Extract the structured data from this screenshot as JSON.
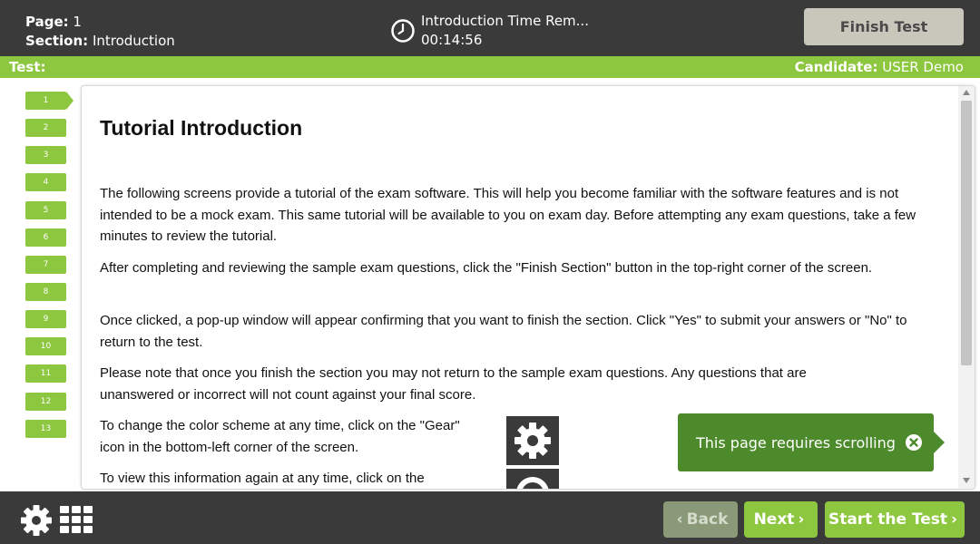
{
  "header": {
    "page_label": "Page:",
    "page_value": "1",
    "section_label": "Section:",
    "section_value": "Introduction",
    "timer_title": "Introduction Time Rem...",
    "timer_value": "00:14:56",
    "timer_icon": "clock-icon",
    "finish_button": "Finish Test"
  },
  "info_bar": {
    "test_label": "Test:",
    "candidate_label": "Candidate:",
    "candidate_name": "USER Demo"
  },
  "question_nav": {
    "items": [
      "1",
      "2",
      "3",
      "4",
      "5",
      "6",
      "7",
      "8",
      "9",
      "10",
      "11",
      "12",
      "13"
    ],
    "active": "1"
  },
  "content": {
    "title": "Tutorial Introduction",
    "paragraphs": [
      "The following screens provide a tutorial of the exam software. This will help you become familiar with the software features and is not intended to be a mock exam. This same tutorial will be available to you on exam day. Before attempting any exam questions, take a few minutes to review the tutorial.",
      "After completing and reviewing the sample exam questions, click the \"Finish Section\" button in the top-right corner of the screen.",
      "Once clicked, a pop-up window will appear confirming that you want to finish the section. Click \"Yes\" to submit your answers or \"No\" to return to the test.",
      "Please note that once you finish the section you may not return to the sample exam questions. Any questions that are unanswered or incorrect will not count against your final score.",
      "To change the color scheme at any time, click on the \"Gear\" icon in the bottom-left corner of the screen.",
      "To view this information again at any time, click on the"
    ]
  },
  "scroll_tip": {
    "text": "This page requires scrolling",
    "close_icon": "close-circle-icon"
  },
  "footer": {
    "settings_icon": "gear-icon",
    "grid_icon": "grid-icon",
    "back_label": "Back",
    "next_label": "Next",
    "start_label": "Start the Test"
  },
  "colors": {
    "dark_bar": "#3a3a3a",
    "accent_green": "#8dc63f",
    "tip_green": "#4c8a2b",
    "finish_button": "#c9c6bc"
  }
}
